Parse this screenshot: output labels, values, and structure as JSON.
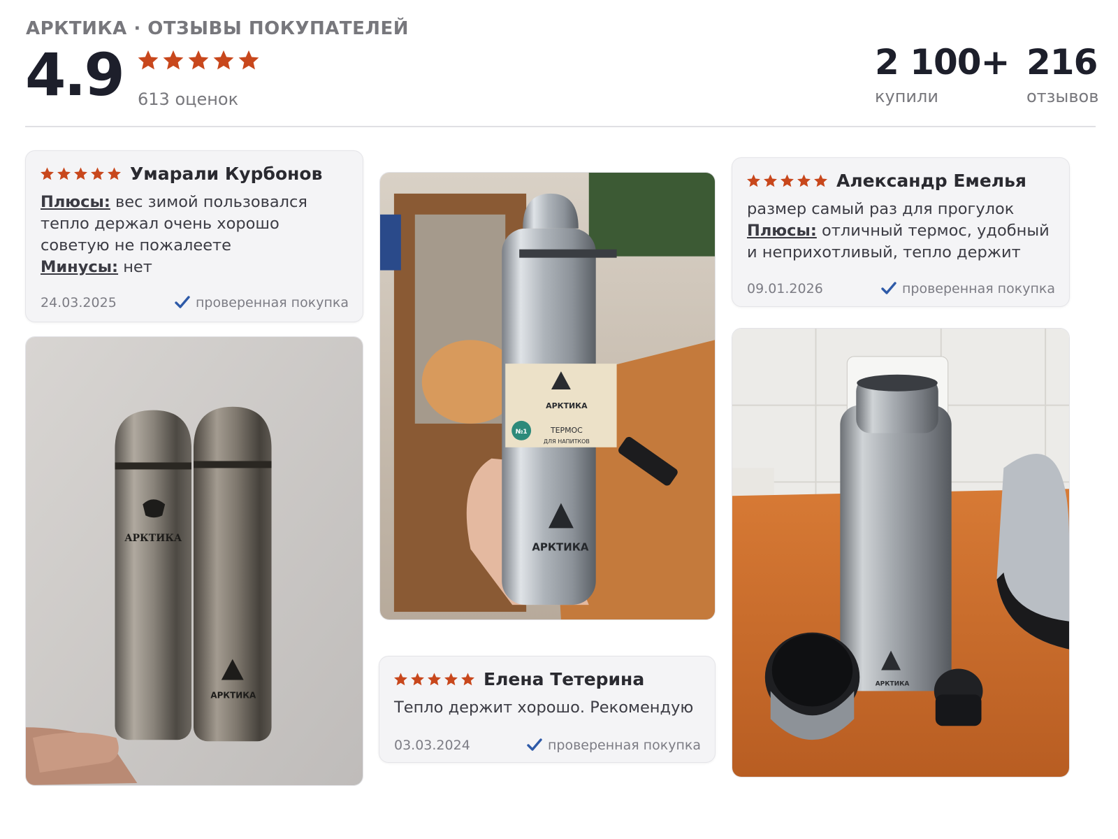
{
  "header": {
    "brand": "АРКТИКА · ОТЗЫВЫ ПОКУПАТЕЛЕЙ",
    "rating": "4.9",
    "rating_stars": 5,
    "ratings_count": "613 оценок",
    "bought_num": "2 100+",
    "bought_label": "купили",
    "reviews_num": "216",
    "reviews_label": "отзывов"
  },
  "colors": {
    "star": "#c8471c",
    "check": "#2e5aa8",
    "text_muted": "#77777c",
    "card_bg": "#f4f4f6"
  },
  "reviews": [
    {
      "author": "Умарали Курбонов",
      "stars": 5,
      "pros_label": "Плюсы:",
      "pros_text": "вес зимой пользовался тепло держал очень хорошо советую не пожалеете",
      "cons_label": "Минусы:",
      "cons_text": "нет",
      "date": "24.03.2025",
      "verified": "проверенная покупка"
    },
    {
      "author": "Александр Емелья",
      "stars": 5,
      "text": "размер самый раз для прогулок",
      "pros_label": "Плюсы:",
      "pros_text": "отличный термос, удобный и неприхотливый, тепло держит",
      "date": "09.01.2026",
      "verified": "проверенная покупка"
    },
    {
      "author": "Елена Тетерина",
      "stars": 5,
      "text": "Тепло держит хорошо. Рекомендую",
      "date": "03.03.2024",
      "verified": "проверенная покупка"
    }
  ],
  "photos": {
    "photo1": {
      "label_top": "АРКТИКА",
      "label_bottom": "АРКТИКА"
    },
    "photo2": {
      "brand": "АРКТИКА",
      "product_line1": "ТЕРМОС",
      "product_line2": "ДЛЯ НАПИТКОВ",
      "sticker": "№1"
    },
    "photo3": {
      "brand": "АРКТИКА"
    }
  }
}
